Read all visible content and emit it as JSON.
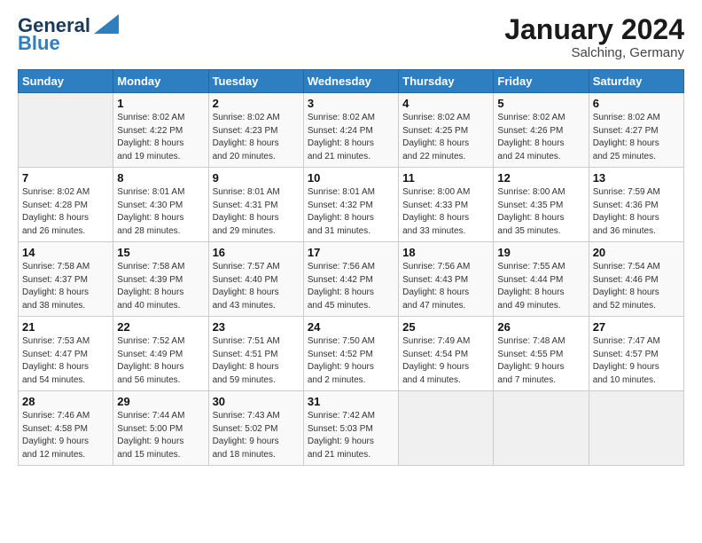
{
  "header": {
    "logo_line1": "General",
    "logo_line2": "Blue",
    "month_year": "January 2024",
    "location": "Salching, Germany"
  },
  "weekdays": [
    "Sunday",
    "Monday",
    "Tuesday",
    "Wednesday",
    "Thursday",
    "Friday",
    "Saturday"
  ],
  "weeks": [
    [
      {
        "day": "",
        "info": ""
      },
      {
        "day": "1",
        "info": "Sunrise: 8:02 AM\nSunset: 4:22 PM\nDaylight: 8 hours\nand 19 minutes."
      },
      {
        "day": "2",
        "info": "Sunrise: 8:02 AM\nSunset: 4:23 PM\nDaylight: 8 hours\nand 20 minutes."
      },
      {
        "day": "3",
        "info": "Sunrise: 8:02 AM\nSunset: 4:24 PM\nDaylight: 8 hours\nand 21 minutes."
      },
      {
        "day": "4",
        "info": "Sunrise: 8:02 AM\nSunset: 4:25 PM\nDaylight: 8 hours\nand 22 minutes."
      },
      {
        "day": "5",
        "info": "Sunrise: 8:02 AM\nSunset: 4:26 PM\nDaylight: 8 hours\nand 24 minutes."
      },
      {
        "day": "6",
        "info": "Sunrise: 8:02 AM\nSunset: 4:27 PM\nDaylight: 8 hours\nand 25 minutes."
      }
    ],
    [
      {
        "day": "7",
        "info": "Sunrise: 8:02 AM\nSunset: 4:28 PM\nDaylight: 8 hours\nand 26 minutes."
      },
      {
        "day": "8",
        "info": "Sunrise: 8:01 AM\nSunset: 4:30 PM\nDaylight: 8 hours\nand 28 minutes."
      },
      {
        "day": "9",
        "info": "Sunrise: 8:01 AM\nSunset: 4:31 PM\nDaylight: 8 hours\nand 29 minutes."
      },
      {
        "day": "10",
        "info": "Sunrise: 8:01 AM\nSunset: 4:32 PM\nDaylight: 8 hours\nand 31 minutes."
      },
      {
        "day": "11",
        "info": "Sunrise: 8:00 AM\nSunset: 4:33 PM\nDaylight: 8 hours\nand 33 minutes."
      },
      {
        "day": "12",
        "info": "Sunrise: 8:00 AM\nSunset: 4:35 PM\nDaylight: 8 hours\nand 35 minutes."
      },
      {
        "day": "13",
        "info": "Sunrise: 7:59 AM\nSunset: 4:36 PM\nDaylight: 8 hours\nand 36 minutes."
      }
    ],
    [
      {
        "day": "14",
        "info": "Sunrise: 7:58 AM\nSunset: 4:37 PM\nDaylight: 8 hours\nand 38 minutes."
      },
      {
        "day": "15",
        "info": "Sunrise: 7:58 AM\nSunset: 4:39 PM\nDaylight: 8 hours\nand 40 minutes."
      },
      {
        "day": "16",
        "info": "Sunrise: 7:57 AM\nSunset: 4:40 PM\nDaylight: 8 hours\nand 43 minutes."
      },
      {
        "day": "17",
        "info": "Sunrise: 7:56 AM\nSunset: 4:42 PM\nDaylight: 8 hours\nand 45 minutes."
      },
      {
        "day": "18",
        "info": "Sunrise: 7:56 AM\nSunset: 4:43 PM\nDaylight: 8 hours\nand 47 minutes."
      },
      {
        "day": "19",
        "info": "Sunrise: 7:55 AM\nSunset: 4:44 PM\nDaylight: 8 hours\nand 49 minutes."
      },
      {
        "day": "20",
        "info": "Sunrise: 7:54 AM\nSunset: 4:46 PM\nDaylight: 8 hours\nand 52 minutes."
      }
    ],
    [
      {
        "day": "21",
        "info": "Sunrise: 7:53 AM\nSunset: 4:47 PM\nDaylight: 8 hours\nand 54 minutes."
      },
      {
        "day": "22",
        "info": "Sunrise: 7:52 AM\nSunset: 4:49 PM\nDaylight: 8 hours\nand 56 minutes."
      },
      {
        "day": "23",
        "info": "Sunrise: 7:51 AM\nSunset: 4:51 PM\nDaylight: 8 hours\nand 59 minutes."
      },
      {
        "day": "24",
        "info": "Sunrise: 7:50 AM\nSunset: 4:52 PM\nDaylight: 9 hours\nand 2 minutes."
      },
      {
        "day": "25",
        "info": "Sunrise: 7:49 AM\nSunset: 4:54 PM\nDaylight: 9 hours\nand 4 minutes."
      },
      {
        "day": "26",
        "info": "Sunrise: 7:48 AM\nSunset: 4:55 PM\nDaylight: 9 hours\nand 7 minutes."
      },
      {
        "day": "27",
        "info": "Sunrise: 7:47 AM\nSunset: 4:57 PM\nDaylight: 9 hours\nand 10 minutes."
      }
    ],
    [
      {
        "day": "28",
        "info": "Sunrise: 7:46 AM\nSunset: 4:58 PM\nDaylight: 9 hours\nand 12 minutes."
      },
      {
        "day": "29",
        "info": "Sunrise: 7:44 AM\nSunset: 5:00 PM\nDaylight: 9 hours\nand 15 minutes."
      },
      {
        "day": "30",
        "info": "Sunrise: 7:43 AM\nSunset: 5:02 PM\nDaylight: 9 hours\nand 18 minutes."
      },
      {
        "day": "31",
        "info": "Sunrise: 7:42 AM\nSunset: 5:03 PM\nDaylight: 9 hours\nand 21 minutes."
      },
      {
        "day": "",
        "info": ""
      },
      {
        "day": "",
        "info": ""
      },
      {
        "day": "",
        "info": ""
      }
    ]
  ]
}
